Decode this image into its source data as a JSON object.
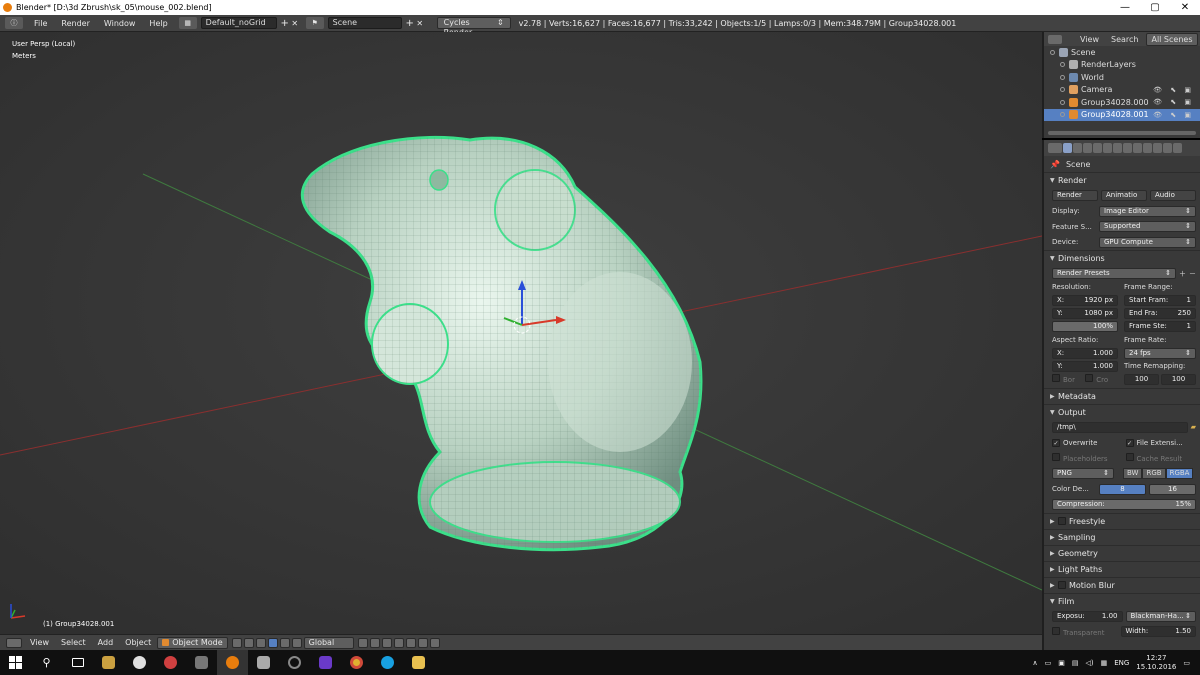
{
  "window": {
    "title": "Blender* [D:\\3d Zbrush\\sk_05\\mouse_002.blend]",
    "min": "—",
    "max": "▢",
    "close": "✕"
  },
  "menu": {
    "items": [
      "File",
      "Render",
      "Window",
      "Help"
    ],
    "layout": "Default_noGrid",
    "scene": "Scene",
    "engine": "Cycles Render",
    "stats": "v2.78 | Verts:16,627 | Faces:16,677 | Tris:33,242 | Objects:1/5 | Lamps:0/3 | Mem:348.79M | Group34028.001"
  },
  "viewport": {
    "view_label": "User Persp (Local)",
    "units_label": "Meters",
    "active_object": "(1) Group34028.001"
  },
  "view_header": {
    "items": [
      "View",
      "Select",
      "Add",
      "Object"
    ],
    "mode": "Object Mode",
    "orientation": "Global"
  },
  "outliner": {
    "tabs": [
      "View",
      "Search",
      "All Scenes"
    ],
    "rows": [
      {
        "label": "Scene",
        "indent": 0,
        "icon_color": "#9aa4b4"
      },
      {
        "label": "RenderLayers",
        "indent": 1,
        "icon_color": "#b0b0b0"
      },
      {
        "label": "World",
        "indent": 1,
        "icon_color": "#6d8ab0"
      },
      {
        "label": "Camera",
        "indent": 1,
        "icon_color": "#e0a060"
      },
      {
        "label": "Group34028.000",
        "indent": 1,
        "icon_color": "#e08a30"
      },
      {
        "label": "Group34028.001",
        "indent": 1,
        "icon_color": "#e08a30",
        "selected": true
      }
    ]
  },
  "properties": {
    "scene": "Scene",
    "render": {
      "header": "Render",
      "tabs": [
        "Render",
        "Animatio",
        "Audio"
      ],
      "display_label": "Display:",
      "display": "Image Editor",
      "feature_label": "Feature S...",
      "feature": "Supported",
      "device_label": "Device:",
      "device": "GPU Compute"
    },
    "dimensions": {
      "header": "Dimensions",
      "presets": "Render Presets",
      "resolution_label": "Resolution:",
      "res_x_label": "X:",
      "res_x": "1920 px",
      "res_y_label": "Y:",
      "res_y": "1080 px",
      "res_pct": "100%",
      "frame_range_label": "Frame Range:",
      "start_label": "Start Fram:",
      "start": "1",
      "end_label": "End Fra:",
      "end": "250",
      "step_label": "Frame Ste:",
      "step": "1",
      "aspect_label": "Aspect Ratio:",
      "asp_x_label": "X:",
      "asp_x": "1.000",
      "asp_y_label": "Y:",
      "asp_y": "1.000",
      "frame_rate_label": "Frame Rate:",
      "fps": "24 fps",
      "remap_label": "Time Remapping:",
      "remap_old": "100",
      "remap_new": "100",
      "border_label": "Bor",
      "crop_label": "Cro"
    },
    "metadata_header": "Metadata",
    "output": {
      "header": "Output",
      "path": "/tmp\\",
      "overwrite": "Overwrite",
      "file_ext": "File Extensi...",
      "placeholders": "Placeholders",
      "cache": "Cache Result",
      "format": "PNG",
      "bw": "BW",
      "rgb": "RGB",
      "rgba": "RGBA",
      "depth_label": "Color De...",
      "depth_8": "8",
      "depth_16": "16",
      "compression_label": "Compression:",
      "compression": "15%"
    },
    "collapsed": [
      "Freestyle",
      "Sampling",
      "Geometry",
      "Light Paths",
      "Motion Blur"
    ],
    "film": {
      "header": "Film",
      "exposure_label": "Exposu:",
      "exposure": "1.00",
      "filter": "Blackman-Ha...",
      "transparent": "Transparent",
      "width_label": "Width:",
      "width": "1.50"
    }
  },
  "taskbar": {
    "lang": "ENG",
    "time": "12:27",
    "date": "15.10.2016"
  }
}
